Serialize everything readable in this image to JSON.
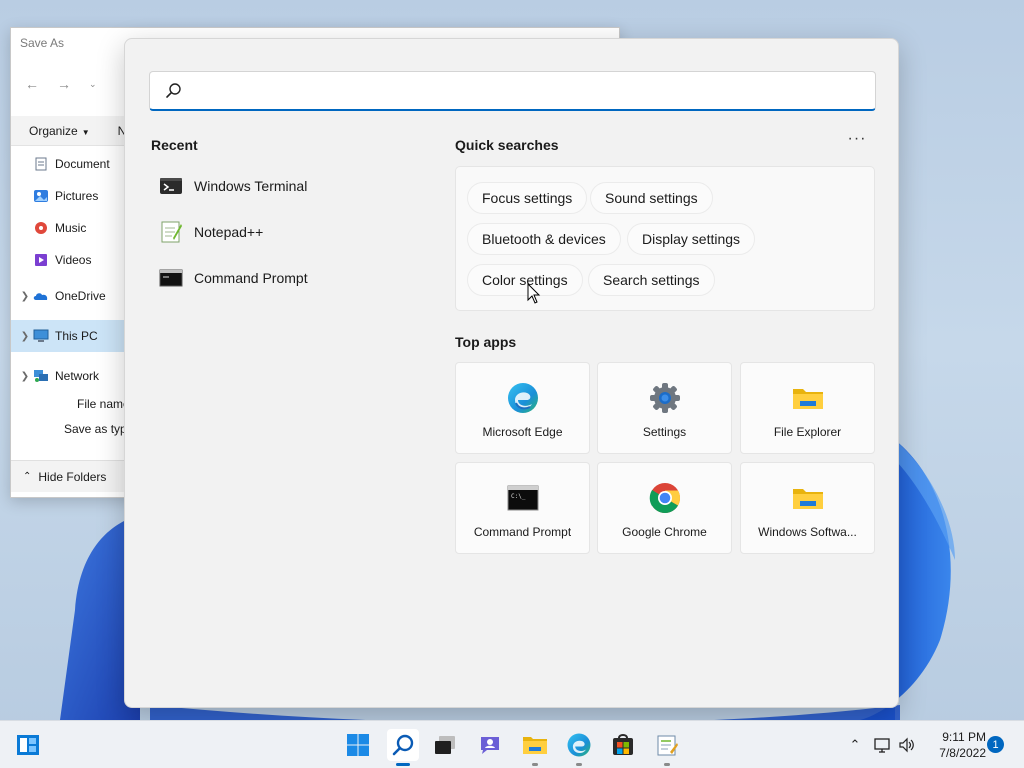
{
  "save_as": {
    "title": "Save As",
    "organize_label": "Organize",
    "toolbar_partial": "N",
    "tree": [
      {
        "label": "Document",
        "icon": "documents-icon",
        "expandable": false
      },
      {
        "label": "Pictures",
        "icon": "pictures-icon",
        "expandable": false
      },
      {
        "label": "Music",
        "icon": "music-icon",
        "expandable": false
      },
      {
        "label": "Videos",
        "icon": "videos-icon",
        "expandable": false
      },
      {
        "label": "OneDrive",
        "icon": "onedrive-icon",
        "expandable": true
      },
      {
        "label": "This PC",
        "icon": "this-pc-icon",
        "expandable": true,
        "selected": true
      },
      {
        "label": "Network",
        "icon": "network-icon",
        "expandable": true
      }
    ],
    "file_name_label": "File name",
    "save_as_type_label": "Save as type",
    "hide_folders_label": "Hide Folders"
  },
  "search": {
    "query": "",
    "placeholder": "",
    "recent_title": "Recent",
    "recent": [
      {
        "label": "Windows Terminal",
        "icon": "windows-terminal-icon"
      },
      {
        "label": "Notepad++",
        "icon": "notepad-plus-plus-icon"
      },
      {
        "label": "Command Prompt",
        "icon": "command-prompt-icon"
      }
    ],
    "quick_searches_title": "Quick searches",
    "more_label": "···",
    "quick_searches": [
      "Focus settings",
      "Sound settings",
      "Bluetooth & devices",
      "Display settings",
      "Color settings",
      "Search settings"
    ],
    "top_apps_title": "Top apps",
    "top_apps": [
      {
        "label": "Microsoft Edge",
        "icon": "edge-icon"
      },
      {
        "label": "Settings",
        "icon": "settings-gear-icon"
      },
      {
        "label": "File Explorer",
        "icon": "folder-icon"
      },
      {
        "label": "Command Prompt",
        "icon": "command-prompt-icon"
      },
      {
        "label": "Google Chrome",
        "icon": "chrome-icon"
      },
      {
        "label": "Windows Softwa...",
        "icon": "folder-icon"
      }
    ]
  },
  "taskbar": {
    "apps": [
      "start-icon",
      "search-icon",
      "task-view-icon",
      "chat-icon",
      "file-explorer-icon",
      "edge-icon",
      "store-icon",
      "notepad-icon"
    ],
    "time": "9:11 PM",
    "date": "7/8/2022",
    "notification_count": "1"
  },
  "colors": {
    "accent": "#0067c0",
    "flyout_bg": "#f2f2f2",
    "taskbar_bg": "#eef1f5"
  }
}
